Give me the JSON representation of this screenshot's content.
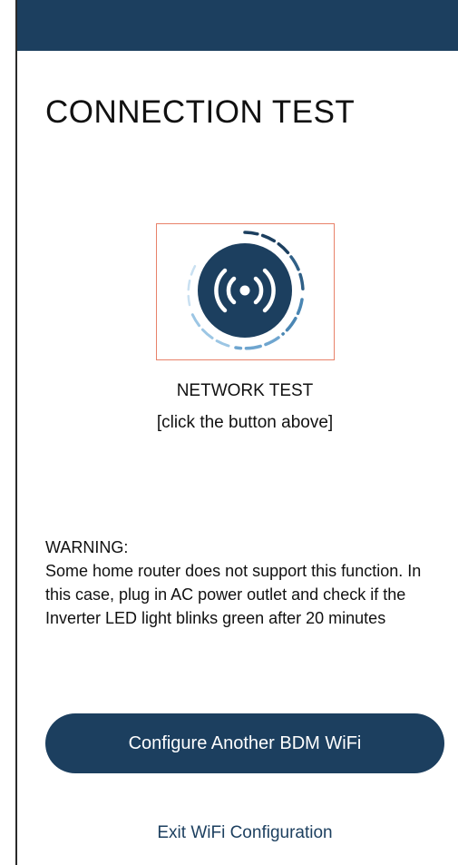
{
  "header": {
    "bar_color": "#1c3f5f"
  },
  "page": {
    "title": "CONNECTION TEST"
  },
  "network_test": {
    "icon": "wifi-broadcast-icon",
    "label": "NETWORK TEST",
    "hint": "[click the button above]",
    "highlight_color": "#e8826a"
  },
  "warning": {
    "heading": "WARNING:",
    "body": "Some home router does not support this function. In this case, plug in AC power outlet and check if the Inverter LED light blinks green after 20 minutes"
  },
  "actions": {
    "configure_label": "Configure Another BDM WiFi",
    "exit_label": "Exit WiFi Configuration"
  },
  "colors": {
    "primary": "#1c3f5f",
    "ring_light": "#a9cde6",
    "ring_mid": "#5d9ac4",
    "ring_dark": "#1c3f5f"
  }
}
